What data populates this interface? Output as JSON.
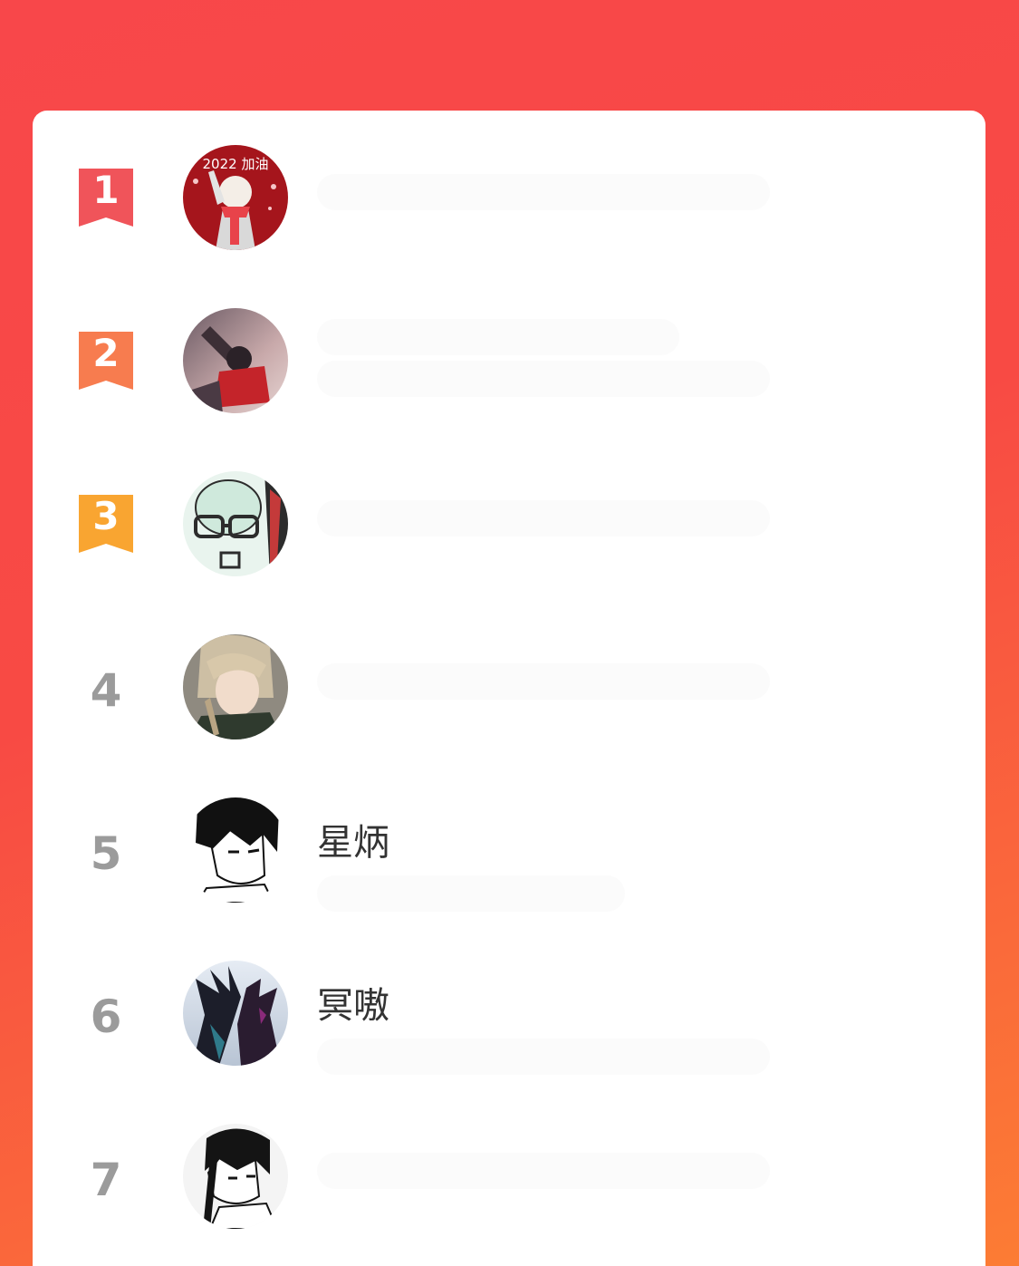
{
  "colors": {
    "background_top": "#f8474a",
    "background_bottom": "#fc7c34",
    "card": "#ffffff",
    "rank_1": "#f0545a",
    "rank_2": "#f77c4f",
    "rank_3": "#f9a531",
    "rank_plain": "#9b9b9b",
    "name_text": "#333333"
  },
  "ranking": {
    "entries": [
      {
        "rank": "1",
        "name": "",
        "avatar_icon": "avatar-2022-jiayou-icon"
      },
      {
        "rank": "2",
        "name": "",
        "avatar_icon": "avatar-anime-red-icon"
      },
      {
        "rank": "3",
        "name": "",
        "avatar_icon": "avatar-glasses-doodle-icon"
      },
      {
        "rank": "4",
        "name": "",
        "avatar_icon": "avatar-anime-blond-icon"
      },
      {
        "rank": "5",
        "name": "星炳",
        "avatar_icon": "avatar-manga-boy-icon"
      },
      {
        "rank": "6",
        "name": "冥嗷",
        "avatar_icon": "avatar-dark-creature-icon"
      },
      {
        "rank": "7",
        "name": "",
        "avatar_icon": "avatar-manga-swordsman-icon"
      }
    ],
    "avatar_1_text": "2022 加油"
  }
}
